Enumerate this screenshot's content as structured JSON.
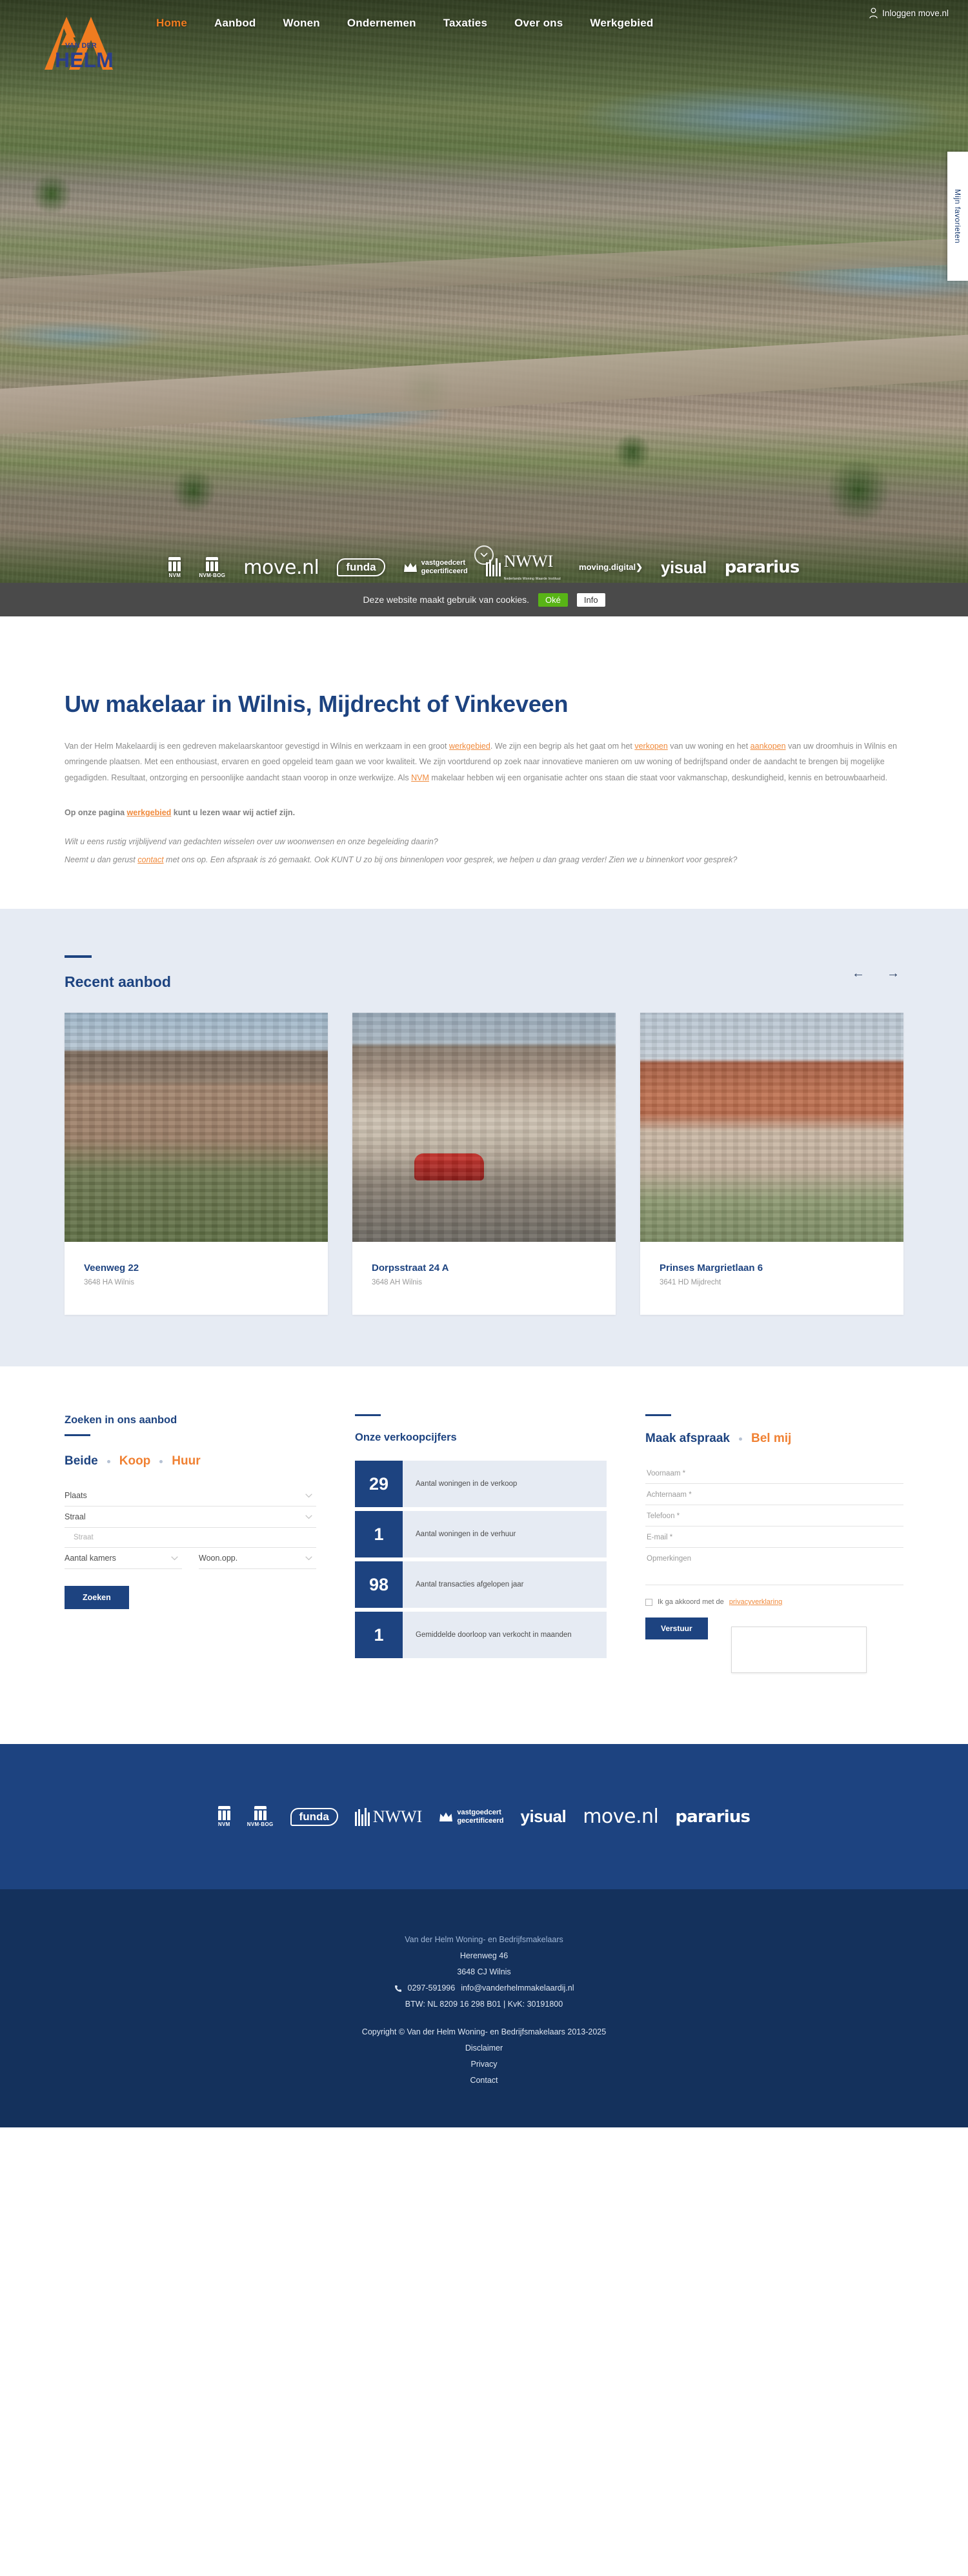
{
  "brand": {
    "name": "VAN DER HELM",
    "logo_line1": "VAN DER",
    "logo_line2": "HELM",
    "accent_orange": "#f07c20",
    "accent_blue": "#1d4380"
  },
  "nav": {
    "items": [
      {
        "label": "Home",
        "active": true
      },
      {
        "label": "Aanbod",
        "active": false
      },
      {
        "label": "Wonen",
        "active": false
      },
      {
        "label": "Ondernemen",
        "active": false
      },
      {
        "label": "Taxaties",
        "active": false
      },
      {
        "label": "Over ons",
        "active": false
      },
      {
        "label": "Werkgebied",
        "active": false
      }
    ],
    "login_label": "Inloggen move.nl",
    "favourites_label": "Mijn favorieten"
  },
  "cookie": {
    "text": "Deze website maakt gebruik van cookies.",
    "accept_label": "Oké",
    "info_label": "Info",
    "accept_color": "#58b416"
  },
  "partners": [
    {
      "name": "NVM",
      "caption": "NVM"
    },
    {
      "name": "NVM-BOG",
      "caption": "NVM·BOG"
    },
    {
      "name": "move.nl",
      "caption": "move.nl"
    },
    {
      "name": "funda",
      "caption": "funda"
    },
    {
      "name": "vastgoedcert",
      "caption_1": "vastgoedcert",
      "caption_2": "gecertificeerd"
    },
    {
      "name": "NWWI",
      "caption": "NWWI",
      "sub": "Nederlands Woning Waarde Instituut"
    },
    {
      "name": "moving.digital",
      "caption_1": "moving",
      "caption_2": ".digital"
    },
    {
      "name": "yisual",
      "caption": "yisual"
    },
    {
      "name": "pararius",
      "caption": "pararius"
    }
  ],
  "intro": {
    "heading": "Uw makelaar in Wilnis, Mijdrecht of Vinkeveen",
    "para1_a": "Van der Helm Makelaardij is een gedreven makelaarskantoor gevestigd in Wilnis en werkzaam in een groot ",
    "link_werkgebied": "werkgebied",
    "para1_b": ". We zijn een begrip als het gaat om het ",
    "link_verkopen": "verkopen",
    "para1_c": " van uw woning en het ",
    "link_aankopen": "aankopen",
    "para1_d": " van uw droomhuis in Wilnis en omringende plaatsen. Met een enthousiast, ervaren en goed opgeleid team gaan we voor kwaliteit. We zijn voortdurend op zoek naar innovatieve manieren om uw woning of bedrijfspand onder de aandacht te brengen bij mogelijke gegadigden. Resultaat, ontzorging en persoonlijke aandacht staan voorop in onze werkwijze. Als ",
    "link_nvm": "NVM",
    "para1_e": " makelaar hebben wij een organisatie achter ons staan die staat voor vakmanschap, deskundigheid, kennis en betrouwbaarheid.",
    "para2_a": "Op onze pagina ",
    "para2_link": "werkgebied",
    "para2_b": " kunt u lezen waar wij actief zijn.",
    "para3": "Wilt u eens rustig vrijblijvend van gedachten wisselen over uw woonwensen en onze begeleiding daarin?",
    "para4_a": "Neemt u dan gerust ",
    "para4_link": "contact",
    "para4_b": " met ons op. Een afspraak is zó gemaakt. Ook KUNT U zo bij ons binnenlopen voor gesprek, we helpen u dan graag verder! Zien we u binnenkort voor gesprek?"
  },
  "recent": {
    "title": "Recent aanbod",
    "prev_label": "←",
    "next_label": "→",
    "listings": [
      {
        "address": "Veenweg 22",
        "postcode_city": "3648 HA Wilnis"
      },
      {
        "address": "Dorpsstraat 24 A",
        "postcode_city": "3648 AH Wilnis"
      },
      {
        "address": "Prinses Margrietlaan 6",
        "postcode_city": "3641 HD Mijdrecht"
      }
    ]
  },
  "search": {
    "title": "Zoeken in ons aanbod",
    "toggle_both": "Beide",
    "toggle_buy": "Koop",
    "toggle_rent": "Huur",
    "field_plaats": "Plaats",
    "field_straal": "Straal",
    "field_straat_placeholder": "Straat",
    "field_kamers": "Aantal kamers",
    "field_woonopp": "Woon.opp.",
    "submit_label": "Zoeken"
  },
  "stats": {
    "title": "Onze verkoopcijfers",
    "items": [
      {
        "value": "29",
        "label": "Aantal woningen in de verkoop"
      },
      {
        "value": "1",
        "label": "Aantal woningen in de verhuur"
      },
      {
        "value": "98",
        "label": "Aantal transacties afgelopen jaar"
      },
      {
        "value": "1",
        "label": "Gemiddelde doorloop van verkocht in maanden"
      }
    ]
  },
  "appointment": {
    "tab_appointment": "Maak afspraak",
    "tab_callme": "Bel mij",
    "field_firstname": "Voornaam *",
    "field_lastname": "Achternaam *",
    "field_phone": "Telefoon *",
    "field_email": "E-mail *",
    "field_remarks": "Opmerkingen",
    "consent_text": "Ik ga akkoord met de",
    "consent_link": "privacyverklaring",
    "submit_label": "Verstuur"
  },
  "footer": {
    "company": "Van der Helm Woning- en Bedrijfsmakelaars",
    "street": "Herenweg 46",
    "postcode_city": "3648 CJ Wilnis",
    "phone": "0297-591996",
    "email": "info@vanderhelmmakelaardij.nl",
    "vat_kvk": "BTW: NL 8209 16 298 B01 | KvK: 30191800",
    "copyright": "Copyright © Van der Helm Woning- en Bedrijfsmakelaars 2013-2025",
    "links": [
      "Disclaimer",
      "Privacy",
      "Contact"
    ]
  }
}
